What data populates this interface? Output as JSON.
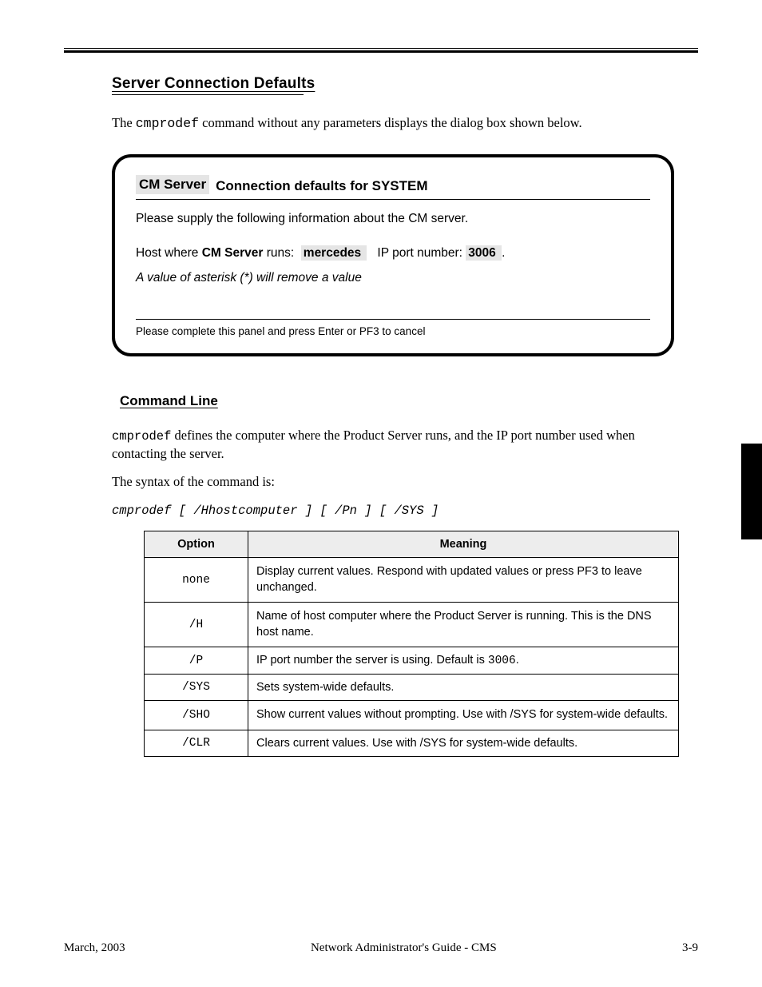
{
  "sectionTitle": "Server Connection Defaults",
  "introText": "The cmprodef command without any parameters displays the dialog box shown below.",
  "panel": {
    "titleHighlight": "CM Server",
    "titlePlain": "Connection defaults for",
    "user": "SYSTEM",
    "hostLabel": "Host where ",
    "hostProduct": "CM Server",
    "hostSuffix": " runs:",
    "hostHighlight": "mercedes       ",
    "portLabel": "IP port number: ",
    "portHighlight": "3006 ",
    "footnote": "Please complete this panel and press Enter or PF3 to cancel"
  },
  "subTitle": "Command Line",
  "para1_pre": "cmprodef",
  "para1_post": " defines the computer where the Product Server runs, and the IP port number used when contacting the server.",
  "para2": "The syntax of the command is:",
  "cmd": "cmprodef [ /Hhostcomputer ] [ /Pn ] [ /SYS ]",
  "table": {
    "head": {
      "option": "Option",
      "meaning": "Meaning"
    },
    "rows": [
      {
        "option": "none",
        "meaning": "Display current values.  Respond with updated values or press PF3 to leave unchanged."
      },
      {
        "option": "/H",
        "meaning": "Name of host computer where the Product Server is running.  This is the DNS host name."
      },
      {
        "option": "/P",
        "meaning_pre": "IP port number the server is using.  Default is ",
        "meaning_mono": "3006",
        "meaning_post": "."
      },
      {
        "option": "/SYS",
        "meaning": "Sets system-wide defaults."
      },
      {
        "option": "/SHO",
        "meaning": "Show current values without prompting.  Use with /SYS for system-wide defaults."
      },
      {
        "option": "/CLR",
        "meaning": "Clears current values.  Use with /SYS for system-wide defaults."
      }
    ]
  },
  "footer": {
    "left": "March, 2003",
    "center": "Network Administrator's Guide - CMS",
    "right": "3-9"
  }
}
